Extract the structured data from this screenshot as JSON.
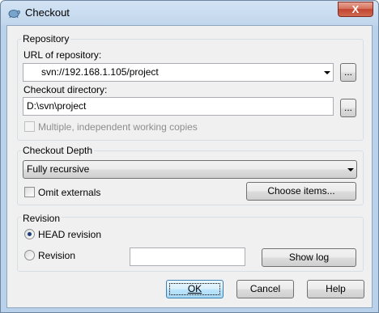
{
  "window": {
    "title": "Checkout",
    "close_glyph": "X"
  },
  "repository": {
    "group_label": "Repository",
    "url_label": "URL of repository:",
    "url_value": "svn://192.168.1.105/project",
    "browse_url_label": "...",
    "dir_label": "Checkout directory:",
    "dir_value": "D:\\svn\\project",
    "browse_dir_label": "...",
    "multiple_wc_label": "Multiple, independent working copies",
    "multiple_wc_checked": false,
    "multiple_wc_enabled": false
  },
  "depth": {
    "group_label": "Checkout Depth",
    "selected": "Fully recursive",
    "omit_externals_label": "Omit externals",
    "omit_externals_checked": false,
    "choose_items_label": "Choose items..."
  },
  "revision": {
    "group_label": "Revision",
    "head_label": "HEAD revision",
    "head_selected": true,
    "revision_label": "Revision",
    "revision_value": "",
    "show_log_label": "Show log"
  },
  "buttons": {
    "ok": "OK",
    "cancel": "Cancel",
    "help": "Help"
  },
  "icons": {
    "app": "tortoise-svn-icon",
    "combo": "chevron-down-icon"
  }
}
